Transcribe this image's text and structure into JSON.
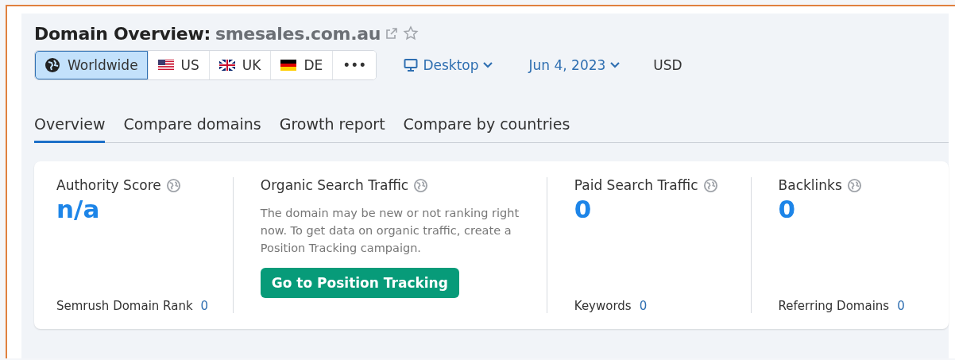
{
  "header": {
    "title": "Domain Overview:",
    "domain": "smesales.com.au",
    "starred": false
  },
  "regions": [
    {
      "kind": "globe",
      "label": "Worldwide",
      "selected": true
    },
    {
      "kind": "us",
      "label": "US",
      "selected": false
    },
    {
      "kind": "uk",
      "label": "UK",
      "selected": false
    },
    {
      "kind": "de",
      "label": "DE",
      "selected": false
    },
    {
      "kind": "more",
      "label": "•••",
      "selected": false
    }
  ],
  "device": {
    "label": "Desktop"
  },
  "date": {
    "label": "Jun 4, 2023"
  },
  "currency": "USD",
  "tabs": [
    {
      "label": "Overview",
      "selected": true
    },
    {
      "label": "Compare domains",
      "selected": false
    },
    {
      "label": "Growth report",
      "selected": false
    },
    {
      "label": "Compare by countries",
      "selected": false
    }
  ],
  "metrics": [
    {
      "kind": "value",
      "title": "Authority Score",
      "value": "n/a",
      "footer_label": "Semrush Domain Rank",
      "footer_value": "0"
    },
    {
      "kind": "message",
      "title": "Organic Search Traffic",
      "message": "The domain may be new or not ranking right now. To get data on organic traffic, create a Position Tracking campaign.",
      "button": "Go to Position Tracking"
    },
    {
      "kind": "value",
      "title": "Paid Search Traffic",
      "value": "0",
      "footer_label": "Keywords",
      "footer_value": "0"
    },
    {
      "kind": "value",
      "title": "Backlinks",
      "value": "0",
      "footer_label": "Referring Domains",
      "footer_value": "0"
    }
  ]
}
